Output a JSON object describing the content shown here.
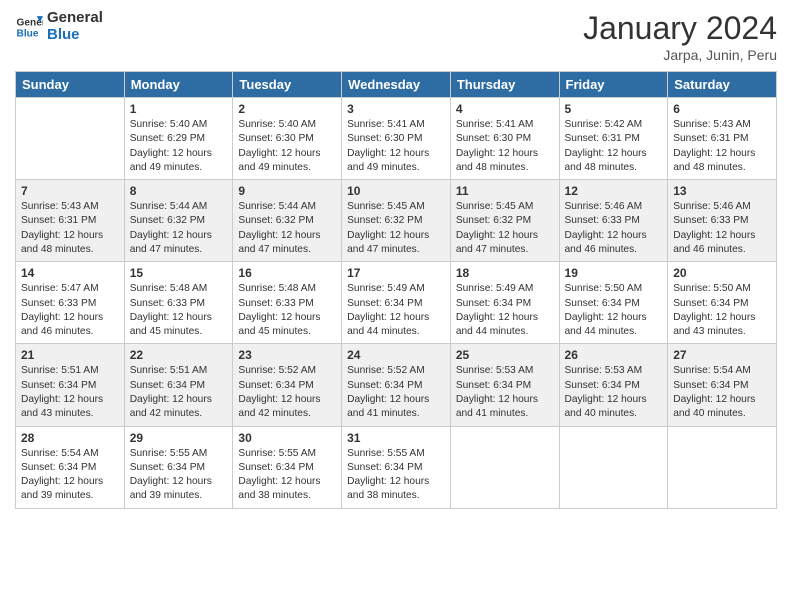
{
  "logo": {
    "line1": "General",
    "line2": "Blue"
  },
  "title": "January 2024",
  "subtitle": "Jarpa, Junin, Peru",
  "days_header": [
    "Sunday",
    "Monday",
    "Tuesday",
    "Wednesday",
    "Thursday",
    "Friday",
    "Saturday"
  ],
  "weeks": [
    [
      {
        "day": "",
        "info": ""
      },
      {
        "day": "1",
        "info": "Sunrise: 5:40 AM\nSunset: 6:29 PM\nDaylight: 12 hours\nand 49 minutes."
      },
      {
        "day": "2",
        "info": "Sunrise: 5:40 AM\nSunset: 6:30 PM\nDaylight: 12 hours\nand 49 minutes."
      },
      {
        "day": "3",
        "info": "Sunrise: 5:41 AM\nSunset: 6:30 PM\nDaylight: 12 hours\nand 49 minutes."
      },
      {
        "day": "4",
        "info": "Sunrise: 5:41 AM\nSunset: 6:30 PM\nDaylight: 12 hours\nand 48 minutes."
      },
      {
        "day": "5",
        "info": "Sunrise: 5:42 AM\nSunset: 6:31 PM\nDaylight: 12 hours\nand 48 minutes."
      },
      {
        "day": "6",
        "info": "Sunrise: 5:43 AM\nSunset: 6:31 PM\nDaylight: 12 hours\nand 48 minutes."
      }
    ],
    [
      {
        "day": "7",
        "info": "Sunrise: 5:43 AM\nSunset: 6:31 PM\nDaylight: 12 hours\nand 48 minutes."
      },
      {
        "day": "8",
        "info": "Sunrise: 5:44 AM\nSunset: 6:32 PM\nDaylight: 12 hours\nand 47 minutes."
      },
      {
        "day": "9",
        "info": "Sunrise: 5:44 AM\nSunset: 6:32 PM\nDaylight: 12 hours\nand 47 minutes."
      },
      {
        "day": "10",
        "info": "Sunrise: 5:45 AM\nSunset: 6:32 PM\nDaylight: 12 hours\nand 47 minutes."
      },
      {
        "day": "11",
        "info": "Sunrise: 5:45 AM\nSunset: 6:32 PM\nDaylight: 12 hours\nand 47 minutes."
      },
      {
        "day": "12",
        "info": "Sunrise: 5:46 AM\nSunset: 6:33 PM\nDaylight: 12 hours\nand 46 minutes."
      },
      {
        "day": "13",
        "info": "Sunrise: 5:46 AM\nSunset: 6:33 PM\nDaylight: 12 hours\nand 46 minutes."
      }
    ],
    [
      {
        "day": "14",
        "info": "Sunrise: 5:47 AM\nSunset: 6:33 PM\nDaylight: 12 hours\nand 46 minutes."
      },
      {
        "day": "15",
        "info": "Sunrise: 5:48 AM\nSunset: 6:33 PM\nDaylight: 12 hours\nand 45 minutes."
      },
      {
        "day": "16",
        "info": "Sunrise: 5:48 AM\nSunset: 6:33 PM\nDaylight: 12 hours\nand 45 minutes."
      },
      {
        "day": "17",
        "info": "Sunrise: 5:49 AM\nSunset: 6:34 PM\nDaylight: 12 hours\nand 44 minutes."
      },
      {
        "day": "18",
        "info": "Sunrise: 5:49 AM\nSunset: 6:34 PM\nDaylight: 12 hours\nand 44 minutes."
      },
      {
        "day": "19",
        "info": "Sunrise: 5:50 AM\nSunset: 6:34 PM\nDaylight: 12 hours\nand 44 minutes."
      },
      {
        "day": "20",
        "info": "Sunrise: 5:50 AM\nSunset: 6:34 PM\nDaylight: 12 hours\nand 43 minutes."
      }
    ],
    [
      {
        "day": "21",
        "info": "Sunrise: 5:51 AM\nSunset: 6:34 PM\nDaylight: 12 hours\nand 43 minutes."
      },
      {
        "day": "22",
        "info": "Sunrise: 5:51 AM\nSunset: 6:34 PM\nDaylight: 12 hours\nand 42 minutes."
      },
      {
        "day": "23",
        "info": "Sunrise: 5:52 AM\nSunset: 6:34 PM\nDaylight: 12 hours\nand 42 minutes."
      },
      {
        "day": "24",
        "info": "Sunrise: 5:52 AM\nSunset: 6:34 PM\nDaylight: 12 hours\nand 41 minutes."
      },
      {
        "day": "25",
        "info": "Sunrise: 5:53 AM\nSunset: 6:34 PM\nDaylight: 12 hours\nand 41 minutes."
      },
      {
        "day": "26",
        "info": "Sunrise: 5:53 AM\nSunset: 6:34 PM\nDaylight: 12 hours\nand 40 minutes."
      },
      {
        "day": "27",
        "info": "Sunrise: 5:54 AM\nSunset: 6:34 PM\nDaylight: 12 hours\nand 40 minutes."
      }
    ],
    [
      {
        "day": "28",
        "info": "Sunrise: 5:54 AM\nSunset: 6:34 PM\nDaylight: 12 hours\nand 39 minutes."
      },
      {
        "day": "29",
        "info": "Sunrise: 5:55 AM\nSunset: 6:34 PM\nDaylight: 12 hours\nand 39 minutes."
      },
      {
        "day": "30",
        "info": "Sunrise: 5:55 AM\nSunset: 6:34 PM\nDaylight: 12 hours\nand 38 minutes."
      },
      {
        "day": "31",
        "info": "Sunrise: 5:55 AM\nSunset: 6:34 PM\nDaylight: 12 hours\nand 38 minutes."
      },
      {
        "day": "",
        "info": ""
      },
      {
        "day": "",
        "info": ""
      },
      {
        "day": "",
        "info": ""
      }
    ]
  ]
}
